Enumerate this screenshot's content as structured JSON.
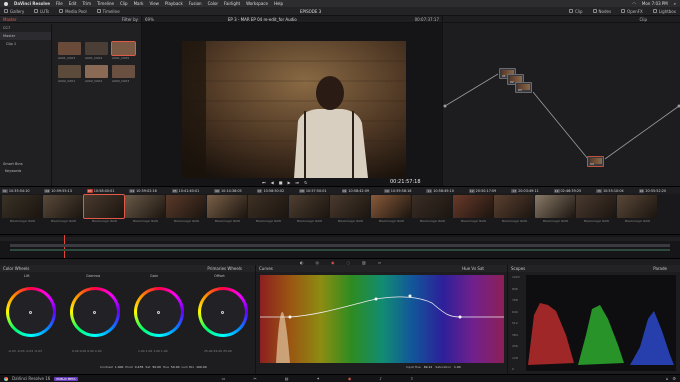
{
  "menubar": {
    "apple": "",
    "items": [
      "DaVinci Resolve",
      "File",
      "Edit",
      "Trim",
      "Timeline",
      "Clip",
      "Mark",
      "View",
      "Playback",
      "Fusion",
      "Color",
      "Fairlight",
      "Workspace",
      "Help"
    ],
    "clock": "Mon 7:03 PM"
  },
  "toolbar": {
    "left": [
      "Gallery",
      "LUTs",
      "Media Pool",
      "Timeline"
    ],
    "center": "EPISODE 3",
    "right": [
      "Clip",
      "Nodes",
      "OpenFX",
      "Lightbox"
    ]
  },
  "media": {
    "header_label": "Master",
    "subheader": "Filter by",
    "sidebar": [
      "CC7",
      "Master",
      "Clip 1"
    ],
    "smart_bins_label": "Smart Bins",
    "keywords_label": "Keywords",
    "clips": [
      {
        "name": "A001_C003",
        "color": "#6a4a38"
      },
      {
        "name": "A001_C004",
        "color": "#4a3e36"
      },
      {
        "name": "A001_C005",
        "color": "#7a5a44"
      },
      {
        "name": "A002_C001",
        "color": "#5c4a3a"
      },
      {
        "name": "A002_C002",
        "color": "#8a6a54"
      },
      {
        "name": "A002_C003",
        "color": "#6a5040"
      }
    ]
  },
  "viewer": {
    "zoom": "69%",
    "clip_title": "EP 3 - MAR EP 04 re-edit_for Audio",
    "timecode_top": "00:07:37:17",
    "timecode": "00:21:57:18"
  },
  "nodes": {
    "header": "Clip",
    "labels": [
      "01",
      "02",
      "03",
      "04"
    ]
  },
  "strip": {
    "clips": [
      {
        "n": "01",
        "tc": "10:35:54:10",
        "color": "#3a3226",
        "name": "Blackmagic RAW"
      },
      {
        "n": "02",
        "tc": "10:59:55:13",
        "color": "#5a4a3a",
        "name": "Blackmagic RAW"
      },
      {
        "n": "03",
        "tc": "10:58:40:01",
        "color": "#4a3a2e",
        "name": "Blackmagic RAW"
      },
      {
        "n": "04",
        "tc": "10:59:02:16",
        "color": "#6a5a48",
        "name": "Blackmagic RAW"
      },
      {
        "n": "05",
        "tc": "10:41:40:01",
        "color": "#5a3a2a",
        "name": "Blackmagic RAW"
      },
      {
        "n": "06",
        "tc": "10:14:38:05",
        "color": "#7a6048",
        "name": "Blackmagic RAW"
      },
      {
        "n": "07",
        "tc": "10:58:50:02",
        "color": "#3e3024",
        "name": "Blackmagic RAW"
      },
      {
        "n": "08",
        "tc": "10:57:50:01",
        "color": "#4e3e30",
        "name": "Blackmagic RAW"
      },
      {
        "n": "09",
        "tc": "10:58:42:09",
        "color": "#4a3a2e",
        "name": "Blackmagic RAW"
      },
      {
        "n": "10",
        "tc": "10:59:58:16",
        "color": "#8a5a3a",
        "name": "Blackmagic RAW"
      },
      {
        "n": "11",
        "tc": "10:58:49:10",
        "color": "#3a2e26",
        "name": "Blackmagic RAW"
      },
      {
        "n": "12",
        "tc": "20:50:17:09",
        "color": "#6a3a2a",
        "name": "Blackmagic RAW"
      },
      {
        "n": "13",
        "tc": "20:03:49:11",
        "color": "#5a4030",
        "name": "Blackmagic RAW"
      },
      {
        "n": "14",
        "tc": "02:46:39:25",
        "color": "#8a7a68",
        "name": "Blackmagic RAW"
      },
      {
        "n": "15",
        "tc": "10:55:10:04",
        "color": "#4a3a30",
        "name": "Blackmagic RAW"
      },
      {
        "n": "16",
        "tc": "20:55:52:20",
        "color": "#5a4838",
        "name": "Blackmagic RAW"
      }
    ]
  },
  "color_wheels": {
    "title": "Color Wheels",
    "mode": "Primaries Wheels",
    "wheels": [
      {
        "label": "Lift",
        "nums": "-0.03  -0.03  -0.03  -0.03"
      },
      {
        "label": "Gamma",
        "nums": "0.00  0.00  0.00  0.00"
      },
      {
        "label": "Gain",
        "nums": "1.00  1.00  1.00  1.00"
      },
      {
        "label": "Offset",
        "nums": "25.00  25.00  25.00"
      }
    ],
    "footer": {
      "contrast_label": "Contrast",
      "contrast": "1.000",
      "pivot_label": "Pivot",
      "pivot": "0.435",
      "sat_label": "Sat",
      "sat": "50.00",
      "hue_label": "Hue",
      "hue": "50.00",
      "lummix_label": "Lum Mix",
      "lummix": "100.00"
    }
  },
  "curves": {
    "title": "Curves",
    "mode": "Hue Vs Sat",
    "input_hue_label": "Input Hue",
    "input_hue": "69.12",
    "saturation_label": "Saturation",
    "saturation": "1.00"
  },
  "scopes": {
    "title": "Scopes",
    "mode": "Parade",
    "ticks": [
      "1023",
      "896",
      "768",
      "640",
      "512",
      "384",
      "256",
      "128",
      "0"
    ]
  },
  "status": {
    "app": "DaVinci Resolve 16",
    "badge": "PUBLIC BETA"
  }
}
